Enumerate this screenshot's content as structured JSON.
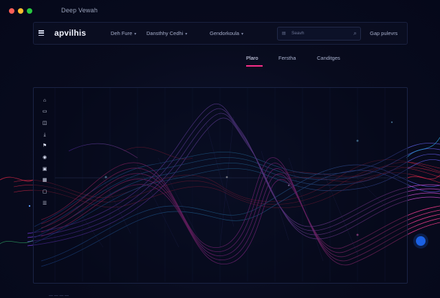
{
  "window": {
    "title": "Deep Vewah"
  },
  "navbar": {
    "brand": "apvilhis",
    "menu": [
      {
        "label": "Deh Fure",
        "has_chevron": true
      },
      {
        "label": "Dansthhy Cedhi",
        "has_chevron": true
      },
      {
        "label": "Gendorkoula",
        "has_chevron": true
      }
    ],
    "search": {
      "placeholder": "Seavh",
      "icon": "search-icon"
    },
    "account": "Gap pulevrs"
  },
  "tabs": [
    {
      "label": "Plaro",
      "active": true
    },
    {
      "label": "Ferstha",
      "active": false
    },
    {
      "label": "Canditges",
      "active": false
    }
  ],
  "toolbar": {
    "tools": [
      {
        "icon": "home-icon"
      },
      {
        "icon": "folder-icon"
      },
      {
        "icon": "layers-icon"
      },
      {
        "icon": "download-icon"
      },
      {
        "icon": "flag-icon"
      },
      {
        "icon": "location-icon"
      },
      {
        "icon": "lock-icon"
      },
      {
        "icon": "grid-icon"
      },
      {
        "icon": "message-icon"
      },
      {
        "icon": "sliders-icon"
      }
    ]
  },
  "footer": {
    "text": "— — — —"
  },
  "colors": {
    "background": "#070b1c",
    "accent_pink": "#ff2e8c",
    "wave_magenta": "#e23cc8",
    "wave_violet": "#8a5cf6",
    "wave_cyan": "#2ea8e6",
    "wave_red": "#e8294a"
  }
}
